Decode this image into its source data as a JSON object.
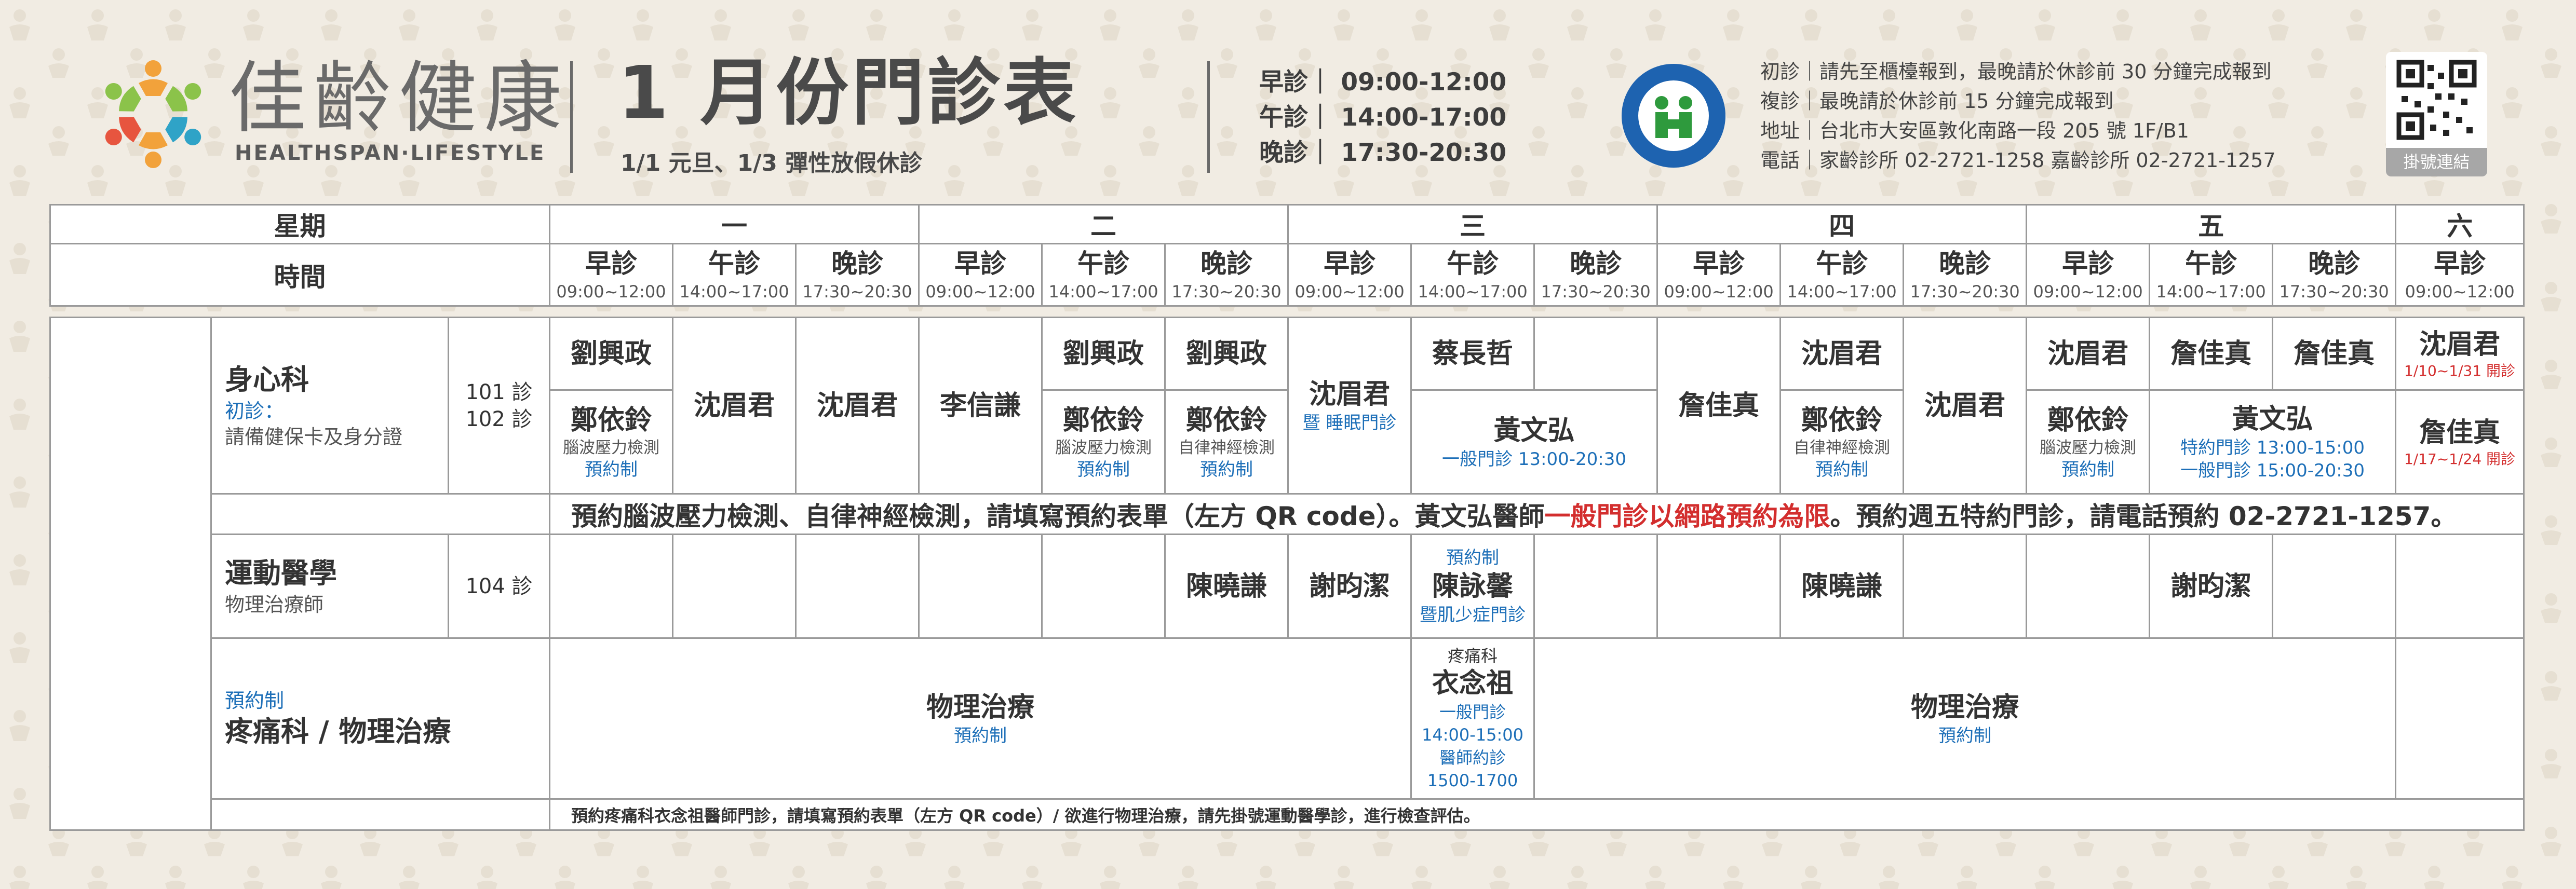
{
  "brand": {
    "name_zh": "佳齡健康",
    "name_en": "HEALTHSPAN·LIFESTYLE"
  },
  "title": {
    "main": "1 月份門診表",
    "sub": "1/1 元旦、1/3 彈性放假休診"
  },
  "hours": {
    "morning": "早診｜ 09:00-12:00",
    "afternoon": "午診｜ 14:00-17:00",
    "evening": "晚診｜ 17:30-20:30"
  },
  "nhi_logo": "nhi-logo",
  "info": {
    "line1": "初診｜請先至櫃檯報到，最晚請於休診前 30 分鐘完成報到",
    "line2": "複診｜最晚請於休診前 15 分鐘完成報到",
    "line3": "地址｜台北市大安區敦化南路一段 205 號 1F/B1",
    "line4": "電話｜家齡診所 02-2721-1258 嘉齡診所 02-2721-1257"
  },
  "qr": {
    "caption": "掛號連結"
  },
  "header_table": {
    "weekday_label": "星期",
    "time_label": "時間",
    "days": [
      "一",
      "二",
      "三",
      "四",
      "五",
      "六"
    ],
    "slot_names": {
      "morning": "早診",
      "afternoon": "午診",
      "evening": "晚診"
    },
    "slot_times": {
      "morning": "09:00~12:00",
      "afternoon": "14:00~17:00",
      "evening": "17:30~20:30"
    }
  },
  "psych": {
    "dept_name": "身心科",
    "first_visit": "初診：",
    "first_visit_note": "請備健保卡及身分證",
    "room1": "101 診",
    "room2": "102 診",
    "mon_m_top": "劉興政",
    "mon_m_bottom": "鄭依鈴",
    "mon_m_note": "腦波壓力檢測",
    "reserve": "預約制",
    "mon_a": "沈眉君",
    "mon_e": "沈眉君",
    "tue_m": "李信謙",
    "tue_a_top": "劉興政",
    "tue_a_bottom": "鄭依鈴",
    "tue_a_note": "腦波壓力檢測",
    "tue_e_top": "劉興政",
    "tue_e_bottom": "鄭依鈴",
    "tue_e_note": "自律神經檢測",
    "wed_m": "沈眉君",
    "wed_m_note": "暨 睡眠門診",
    "wed_a_top": "蔡長哲",
    "wed_ae_bottom": "黃文弘",
    "wed_ae_note": "一般門診 13:00-20:30",
    "thu_m": "詹佳真",
    "thu_a_top": "沈眉君",
    "thu_a_bottom": "鄭依鈴",
    "thu_a_note": "自律神經檢測",
    "thu_e": "沈眉君",
    "fri_m_top": "沈眉君",
    "fri_m_bottom": "鄭依鈴",
    "fri_m_note": "腦波壓力檢測",
    "fri_a_top": "詹佳真",
    "fri_e_top": "詹佳真",
    "fri_ae_bottom": "黃文弘",
    "fri_ae_note1": "特約門診 13:00-15:00",
    "fri_ae_note2": "一般門診 15:00-20:30",
    "sat_top": "沈眉君",
    "sat_top_note": "1/10~1/31 開診",
    "sat_bottom": "詹佳真",
    "sat_bottom_note": "1/17~1/24 開診",
    "remark_a": "預約腦波壓力檢測、自律神經檢測，請填寫預約表單（左方 QR code）。黃文弘醫師",
    "remark_hl": "一般門診以網路預約為限",
    "remark_b": "。預約週五特約門診，請電話預約 02-2721-1257。"
  },
  "sports": {
    "dept_name": "運動醫學",
    "dept_sub": "物理治療師",
    "room": "104 診",
    "tue_e": "陳曉謙",
    "wed_m": "謝昀潔",
    "wed_a_top": "預約制",
    "wed_a": "陳詠馨",
    "wed_a_note": "暨肌少症門診",
    "thu_a": "陳曉謙",
    "fri_a": "謝昀潔"
  },
  "pain": {
    "dept_pre": "預約制",
    "dept_name": "疼痛科 / 物理治療",
    "left_title": "物理治療",
    "left_note": "預約制",
    "mid_dept": "疼痛科",
    "mid_doc": "衣念祖",
    "mid_n1": "一般門診",
    "mid_n2": "14:00-15:00",
    "mid_n3": "醫師約診",
    "mid_n4": "1500-1700",
    "right_title": "物理治療",
    "right_note": "預約制",
    "remark": "預約疼痛科衣念祖醫師門診，請填寫預約表單（左方 QR code）/ 欲進行物理治療，請先掛號運動醫學診，進行檢查評估。"
  }
}
